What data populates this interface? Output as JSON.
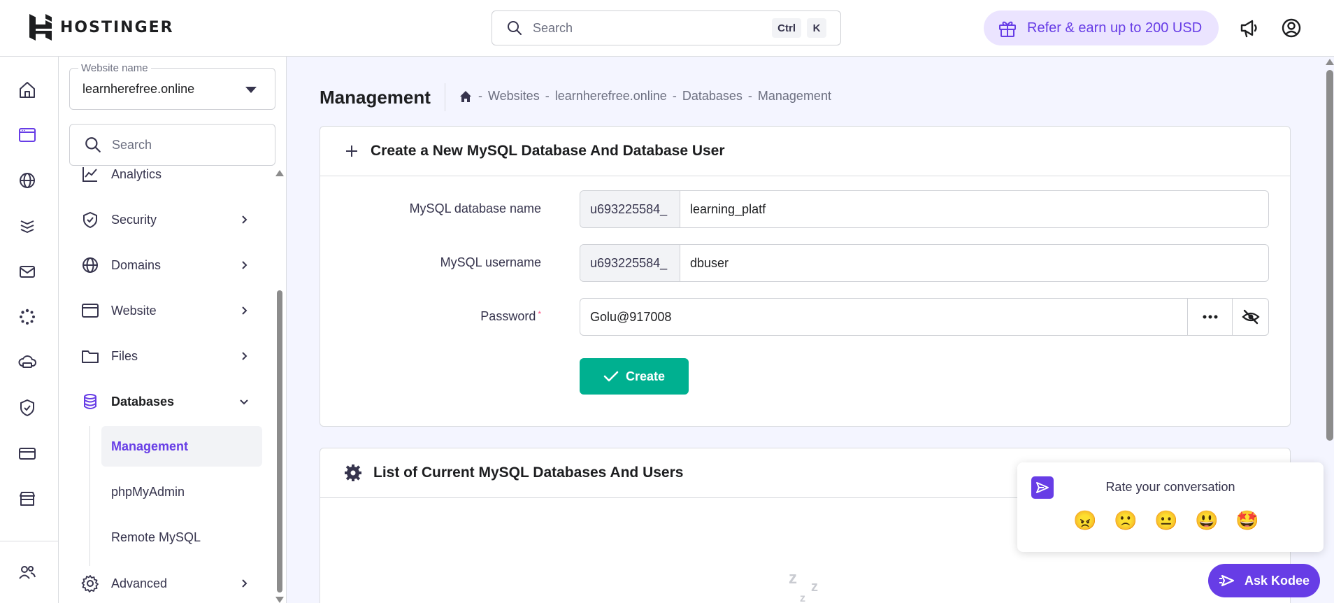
{
  "brand": {
    "name": "HOSTINGER"
  },
  "topbar": {
    "search_placeholder": "Search",
    "shortcut_keys": [
      "Ctrl",
      "K"
    ],
    "refer_label": "Refer & earn up to 200 USD"
  },
  "sidebar": {
    "website_select": {
      "label": "Website name",
      "value": "learnherefree.online"
    },
    "search_placeholder": "Search",
    "items": [
      {
        "label": "Analytics",
        "icon": "chart-line-icon"
      },
      {
        "label": "Security",
        "icon": "shield-check-icon"
      },
      {
        "label": "Domains",
        "icon": "globe-icon"
      },
      {
        "label": "Website",
        "icon": "browser-icon"
      },
      {
        "label": "Files",
        "icon": "folder-icon"
      },
      {
        "label": "Databases",
        "icon": "database-icon",
        "expanded": true
      },
      {
        "label": "Advanced",
        "icon": "gear-icon"
      }
    ],
    "sub_items": [
      {
        "label": "Management",
        "active": true
      },
      {
        "label": "phpMyAdmin"
      },
      {
        "label": "Remote MySQL"
      }
    ]
  },
  "main": {
    "title": "Management",
    "breadcrumb": [
      "Websites",
      "learnherefree.online",
      "Databases",
      "Management"
    ],
    "breadcrumb_sep": "-",
    "create_card": {
      "title": "Create a New MySQL Database And Database User",
      "fields": {
        "db_name": {
          "label": "MySQL database name",
          "prefix": "u693225584_",
          "value": "learning_platf"
        },
        "username": {
          "label": "MySQL username",
          "prefix": "u693225584_",
          "value": "dbuser"
        },
        "password": {
          "label": "Password",
          "required_mark": "*",
          "value": "Golu@917008"
        }
      },
      "create_label": "Create"
    },
    "list_card": {
      "title": "List of Current MySQL Databases And Users"
    }
  },
  "rating_popup": {
    "title": "Rate your conversation",
    "emojis": [
      "😠",
      "🙁",
      "😐",
      "😃",
      "🤩"
    ]
  },
  "kodee": {
    "label": "Ask Kodee"
  },
  "empty_state": {
    "glyphs": [
      "z",
      "z",
      "z"
    ]
  },
  "colors": {
    "accent": "#673de6",
    "success": "#00b090",
    "accent_light": "#ebe4ff"
  }
}
